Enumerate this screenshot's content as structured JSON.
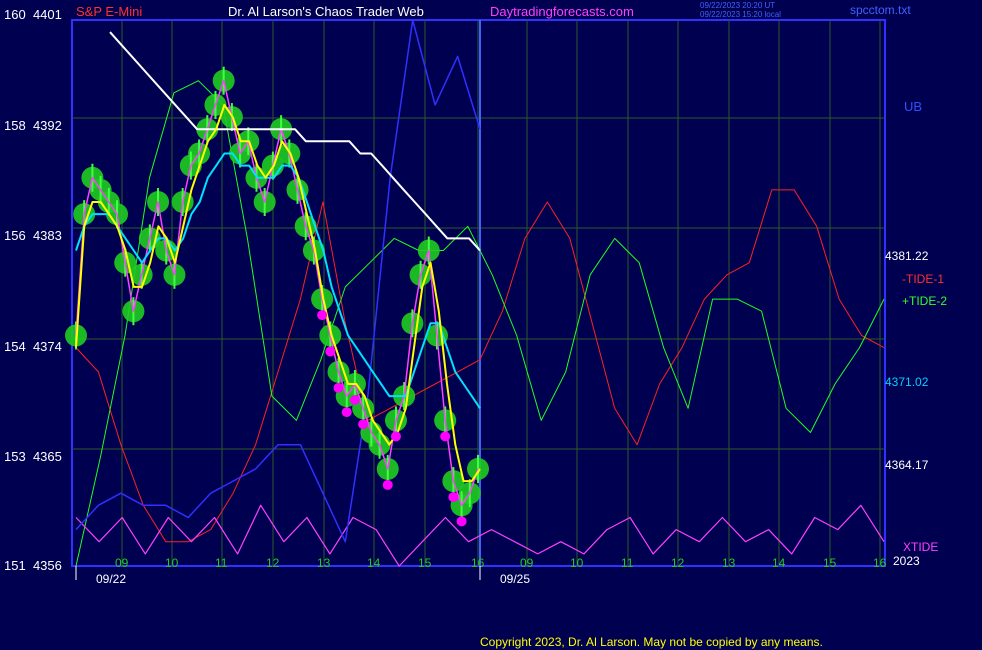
{
  "header": {
    "symbol": "S&P E-Mini",
    "author": "Dr. Al Larson's Chaos Trader Web",
    "site": "Daytradingforecasts.com",
    "time_utc": "09/22/2023 20:20 UT",
    "time_local": "09/22/2023 15:20 local",
    "file": "spcctom.txt"
  },
  "footer": {
    "copyright": "Copyright 2023, Dr. Al Larson. May not be copied by any means."
  },
  "colors": {
    "background": "#000050",
    "grid": "#2a5a2a",
    "frame": "#3030ff",
    "price": "#ff40ff",
    "ma_fast": "#ffff00",
    "ma_mid": "#00e0ff",
    "ma_slow": "#ffffff",
    "tide1": "#ff2020",
    "tide2": "#20ff20",
    "xtide": "#ff40ff",
    "ub": "#3030ff",
    "marker": "#ff00ff",
    "highlight": "#20cc20"
  },
  "chart_data": {
    "type": "line",
    "title": "S&P E-Mini",
    "y_left_labels": [
      {
        "a": "160",
        "b": "4401"
      },
      {
        "a": "158",
        "b": "4392"
      },
      {
        "a": "156",
        "b": "4383"
      },
      {
        "a": "154",
        "b": "4374"
      },
      {
        "a": "153",
        "b": "4365"
      },
      {
        "a": "151",
        "b": "4356"
      }
    ],
    "ylim": [
      4356,
      4401
    ],
    "x_hour_labels_day1": [
      "09",
      "10",
      "11",
      "12",
      "13",
      "14",
      "15",
      "16"
    ],
    "x_hour_labels_day2": [
      "09",
      "10",
      "11",
      "12",
      "13",
      "14",
      "15",
      "16"
    ],
    "x_dates": [
      "09/22",
      "09/25"
    ],
    "year": "2023",
    "right_labels": {
      "ub": "UB",
      "tide1": "-TIDE-1",
      "tide2": "+TIDE-2",
      "xtide": "XTIDE",
      "v1": "4381.22",
      "v2": "4371.02",
      "v3": "4364.17"
    },
    "series": [
      {
        "name": "price",
        "values": [
          4375,
          4385,
          4388,
          4387,
          4386,
          4385,
          4381,
          4377,
          4380,
          4383,
          4386,
          4382,
          4380,
          4386,
          4389,
          4390,
          4392,
          4394,
          4396,
          4393,
          4390,
          4391,
          4388,
          4386,
          4389,
          4392,
          4390,
          4387,
          4384,
          4382,
          4378,
          4375,
          4372,
          4370,
          4371,
          4369,
          4367,
          4366,
          4364,
          4368,
          4370,
          4376,
          4380,
          4382,
          4375,
          4368,
          4363,
          4361,
          4362,
          4364
        ]
      },
      {
        "name": "ma_fast",
        "values": [
          4374,
          4384,
          4386,
          4386,
          4385,
          4384,
          4382,
          4379,
          4379,
          4381,
          4384,
          4383,
          4381,
          4384,
          4387,
          4389,
          4391,
          4392,
          4394,
          4393,
          4391,
          4391,
          4389,
          4388,
          4389,
          4391,
          4390,
          4388,
          4385,
          4382,
          4378,
          4375,
          4373,
          4371,
          4371,
          4370,
          4368,
          4367,
          4366,
          4367,
          4369,
          4374,
          4379,
          4381,
          4377,
          4371,
          4366,
          4363,
          4363,
          4364
        ]
      },
      {
        "name": "ma_mid",
        "values": [
          4382,
          4384,
          4385,
          4385,
          4385,
          4384,
          4383,
          4382,
          4381,
          4382,
          4383,
          4383,
          4382,
          4383,
          4385,
          4386,
          4388,
          4389,
          4390,
          4390,
          4389,
          4389,
          4388,
          4388,
          4388,
          4389,
          4389,
          4388,
          4386,
          4384,
          4382,
          4379,
          4377,
          4375,
          4374,
          4373,
          4372,
          4371,
          4370,
          4370,
          4370,
          4372,
          4374,
          4376,
          4376,
          4374,
          4372,
          4371,
          4370,
          4369
        ]
      },
      {
        "name": "ma_slow",
        "values": [
          4400,
          4399,
          4398,
          4397,
          4396,
          4395,
          4394,
          4393,
          4392,
          4392,
          4392,
          4392,
          4392,
          4392,
          4392,
          4392,
          4392,
          4392,
          4391,
          4391,
          4391,
          4391,
          4391,
          4390,
          4390,
          4389,
          4388,
          4387,
          4386,
          4385,
          4384,
          4383,
          4383,
          4383,
          4382
        ]
      },
      {
        "name": "tide1",
        "values": [
          4374,
          4372,
          4366,
          4361,
          4358,
          4358,
          4359,
          4362,
          4366,
          4372,
          4378,
          4386,
          4376,
          4368,
          4369,
          4370,
          4371,
          4372,
          4373,
          4377,
          4383,
          4386,
          4383,
          4376,
          4369,
          4366,
          4371,
          4374,
          4378,
          4380,
          4381,
          4387,
          4387,
          4384,
          4378,
          4375,
          4374
        ]
      },
      {
        "name": "tide2",
        "values": [
          4356,
          4365,
          4375,
          4388,
          4395,
          4396,
          4394,
          4383,
          4370,
          4368,
          4373,
          4379,
          4381,
          4383,
          4382,
          4382,
          4384,
          4380,
          4375,
          4368,
          4372,
          4380,
          4383,
          4381,
          4374,
          4369,
          4378,
          4378,
          4377,
          4369,
          4367,
          4371,
          4374,
          4378
        ]
      },
      {
        "name": "ub",
        "values": [
          4359,
          4361,
          4362,
          4361,
          4361,
          4360,
          4362,
          4363,
          4364,
          4366,
          4366,
          4362,
          4358,
          4370,
          4388,
          4401,
          4394,
          4398,
          4392
        ]
      },
      {
        "name": "xtide",
        "values": [
          4360,
          4358,
          4360,
          4357,
          4360,
          4358,
          4360,
          4357,
          4361,
          4358,
          4360,
          4357,
          4360,
          4359,
          4356,
          4358,
          4360,
          4358,
          4359,
          4358,
          4357,
          4358,
          4357,
          4359,
          4360,
          4357,
          4359,
          4358,
          4360,
          4358,
          4359,
          4357,
          4360,
          4359,
          4361,
          4358
        ]
      }
    ]
  }
}
